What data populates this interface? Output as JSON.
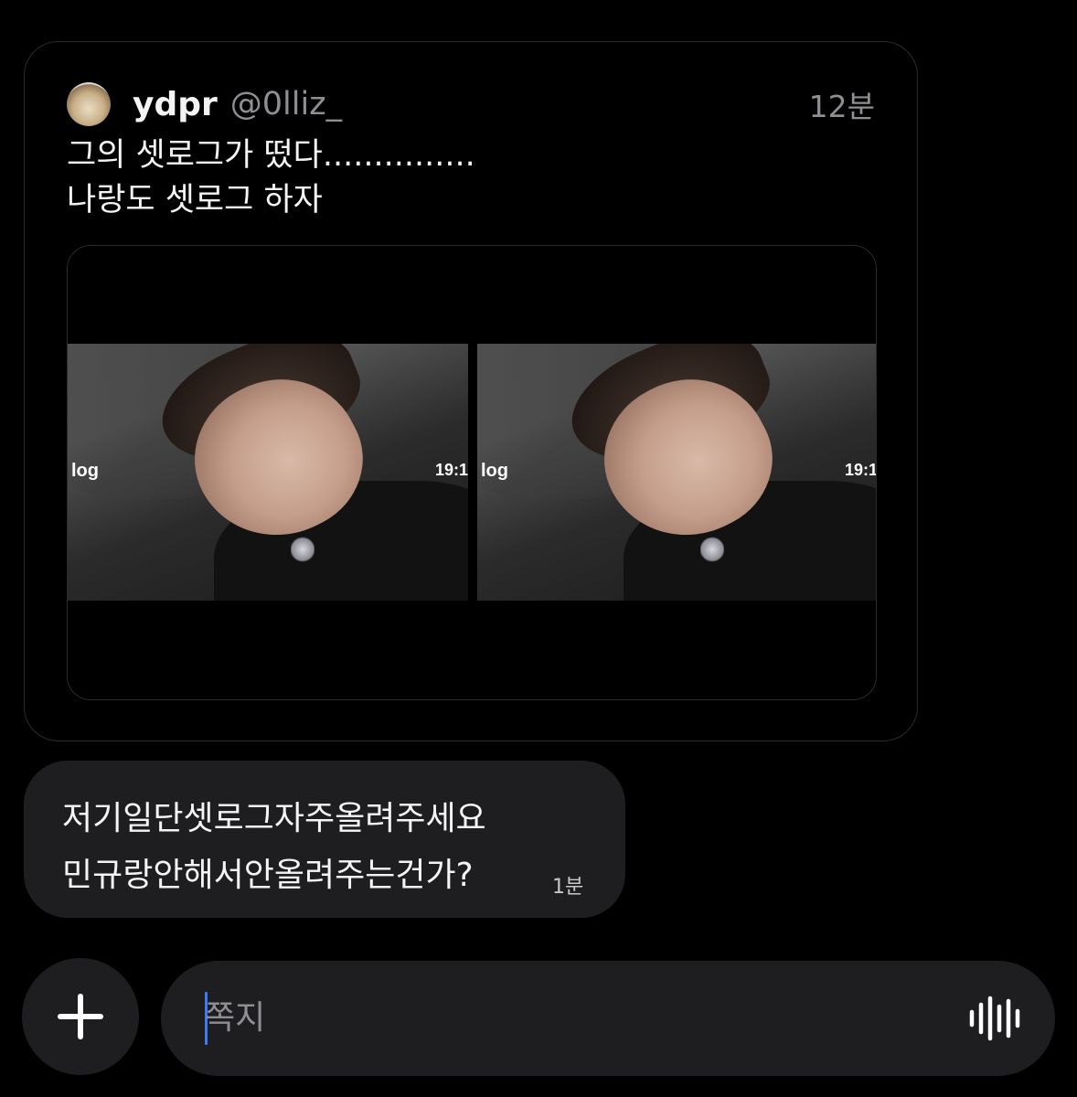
{
  "shared_post": {
    "author_name": "ydpr",
    "author_handle": "@0lliz_",
    "time": "12분",
    "text_lines": [
      "그의 셋로그가 떴다...............",
      "나랑도 셋로그 하자"
    ],
    "media": [
      {
        "overlay_left": "log",
        "overlay_right": "19:1"
      },
      {
        "overlay_left": "log",
        "overlay_right": "19:1"
      }
    ]
  },
  "message": {
    "lines": [
      "저기일단셋로그자주올려주세요",
      "민규랑안해서안올려주는건가?"
    ],
    "time": "1분"
  },
  "composer": {
    "placeholder": "쪽지",
    "add_icon": "plus-icon",
    "voice_icon": "waveform-icon"
  },
  "colors": {
    "background": "#000000",
    "bubble": "#1e1e21",
    "muted_text": "#8e8e93",
    "caret": "#3b7cf6"
  }
}
